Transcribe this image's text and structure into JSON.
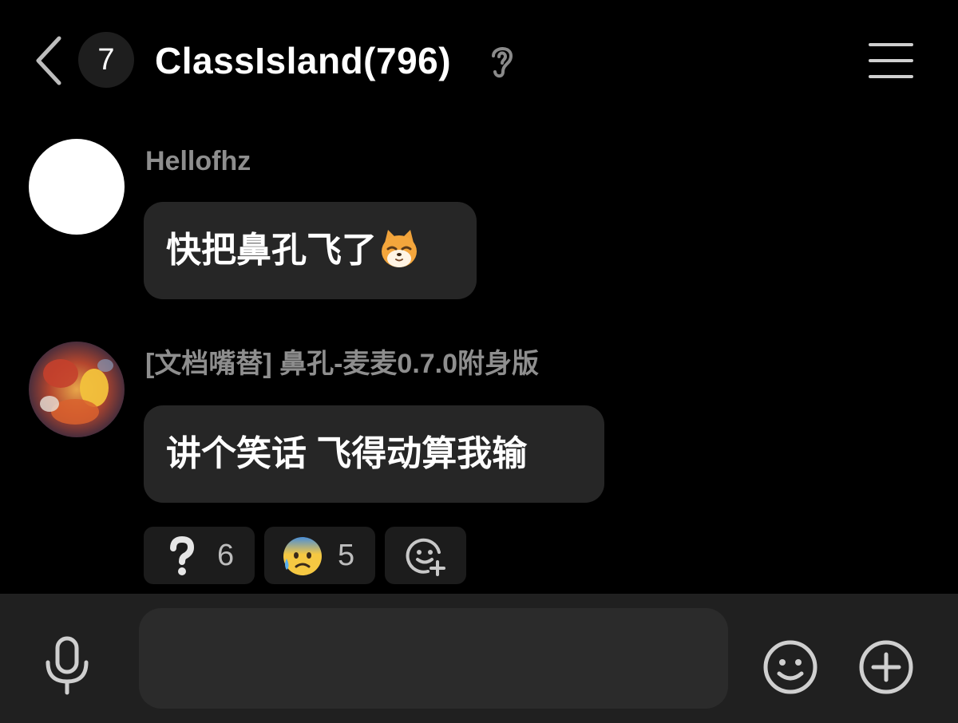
{
  "header": {
    "unread_count": "7",
    "title": "ClassIsland(796)",
    "icons": {
      "back": "chevron-left-icon",
      "listen_mode": "ear-icon",
      "menu": "hamburger-menu-icon"
    }
  },
  "messages": [
    {
      "sender": "Hellofhz",
      "text": "快把鼻孔飞了",
      "inline_emoji": "shiba-smirk-emoji"
    },
    {
      "sender": "[文档嘴替] 鼻孔-麦麦0.7.0附身版",
      "text": "讲个笑话 飞得动算我输",
      "reactions": [
        {
          "icon": "question-mark-icon",
          "count": "6"
        },
        {
          "icon": "anxious-sweat-face-icon",
          "count": "5"
        }
      ],
      "add_reaction_icon": "add-reaction-icon"
    }
  ],
  "input_bar": {
    "placeholder": "",
    "value": "",
    "icons": {
      "voice": "microphone-icon",
      "emoji": "smiley-icon",
      "more": "plus-circle-icon"
    }
  },
  "colors": {
    "background": "#000000",
    "bubble": "#262626",
    "sender_name": "#8e8e8e",
    "input_bar": "#202020",
    "input_field": "#2b2b2b"
  }
}
